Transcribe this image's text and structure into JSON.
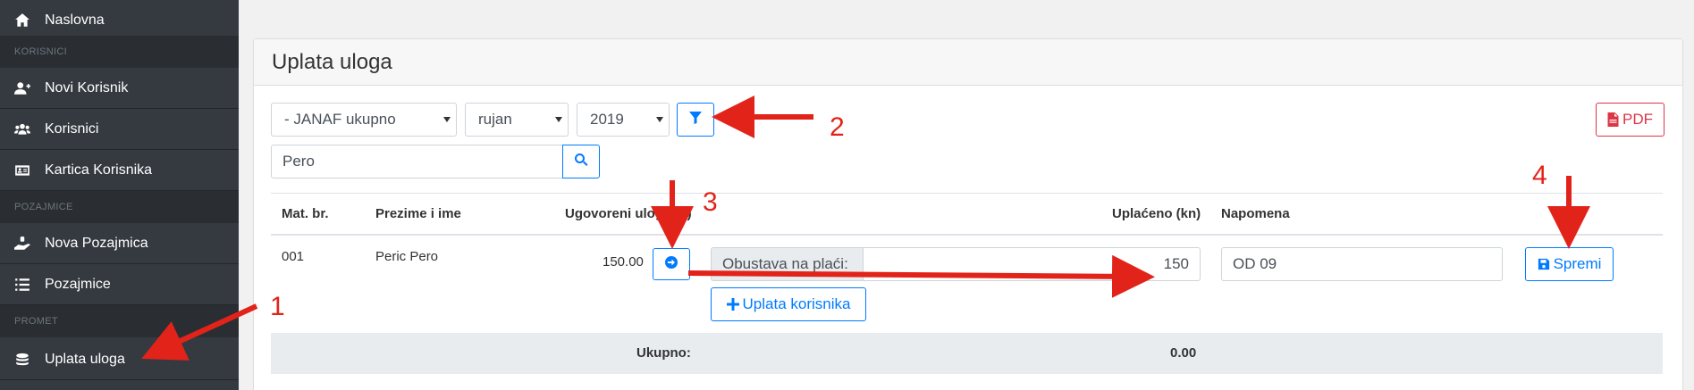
{
  "sidebar": {
    "items": [
      {
        "label": "Naslovna",
        "icon": "home-icon"
      },
      {
        "label": "Novi Korisnik",
        "icon": "user-plus-icon"
      },
      {
        "label": "Korisnici",
        "icon": "users-icon"
      },
      {
        "label": "Kartica Korisnika",
        "icon": "id-card-icon"
      },
      {
        "label": "Nova Pozajmica",
        "icon": "hand-holding-icon"
      },
      {
        "label": "Pozajmice",
        "icon": "list-icon"
      },
      {
        "label": "Uplata uloga",
        "icon": "coins-icon"
      }
    ],
    "headers": [
      "KORISNICI",
      "POZAJMICE",
      "PROMET"
    ]
  },
  "page": {
    "title": "Uplata uloga"
  },
  "filters": {
    "group": "- JANAF ukupno",
    "month": "rujan",
    "year": "2019",
    "search_value": "Pero",
    "pdf_label": "PDF"
  },
  "table": {
    "headers": [
      "Mat. br.",
      "Prezime i ime",
      "Ugovoreni ulog (kn)",
      "Uplaćeno (kn)",
      "Napomena"
    ],
    "row": {
      "mat_br": "001",
      "name": "Peric Pero",
      "ulog": "150.00",
      "addon_label": "Obustava na plaći:",
      "uplaceno": "150",
      "napomena": "OD 09",
      "save_label": "Spremi",
      "add_payment_label": "Uplata korisnika"
    },
    "total": {
      "label": "Ukupno:",
      "value": "0.00"
    }
  },
  "annotations": [
    "1",
    "2",
    "3",
    "4"
  ],
  "colors": {
    "sidebar_bg": "#343a40",
    "primary": "#007bff",
    "danger": "#dc3545",
    "annotation_red": "#e2231a"
  }
}
